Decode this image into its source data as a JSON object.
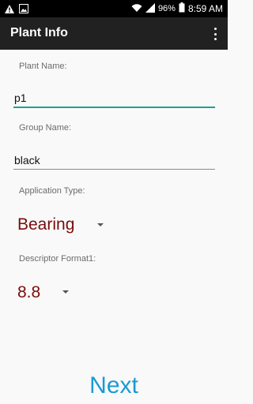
{
  "status_bar": {
    "icons_left": [
      "warning-icon",
      "image-icon"
    ],
    "icons_right": [
      "wifi-icon",
      "signal-icon",
      "battery-icon"
    ],
    "battery": "96%",
    "time": "8:59 AM"
  },
  "app_bar": {
    "title": "Plant Info",
    "menu_icon": "overflow-menu-icon"
  },
  "form": {
    "plant_name_label": "Plant Name:",
    "plant_name_value": "p1",
    "group_name_label": "Group Name:",
    "group_name_value": "black",
    "application_type_label": "Application Type:",
    "application_type_value": "Bearing",
    "descriptor_format_label": "Descriptor Format1:",
    "descriptor_format_value": "8.8"
  },
  "next_label": "Next",
  "colors": {
    "focused_underline": "#1aa38f",
    "spinner_text": "#7a0c0c",
    "next_text": "#1a9bd3"
  }
}
